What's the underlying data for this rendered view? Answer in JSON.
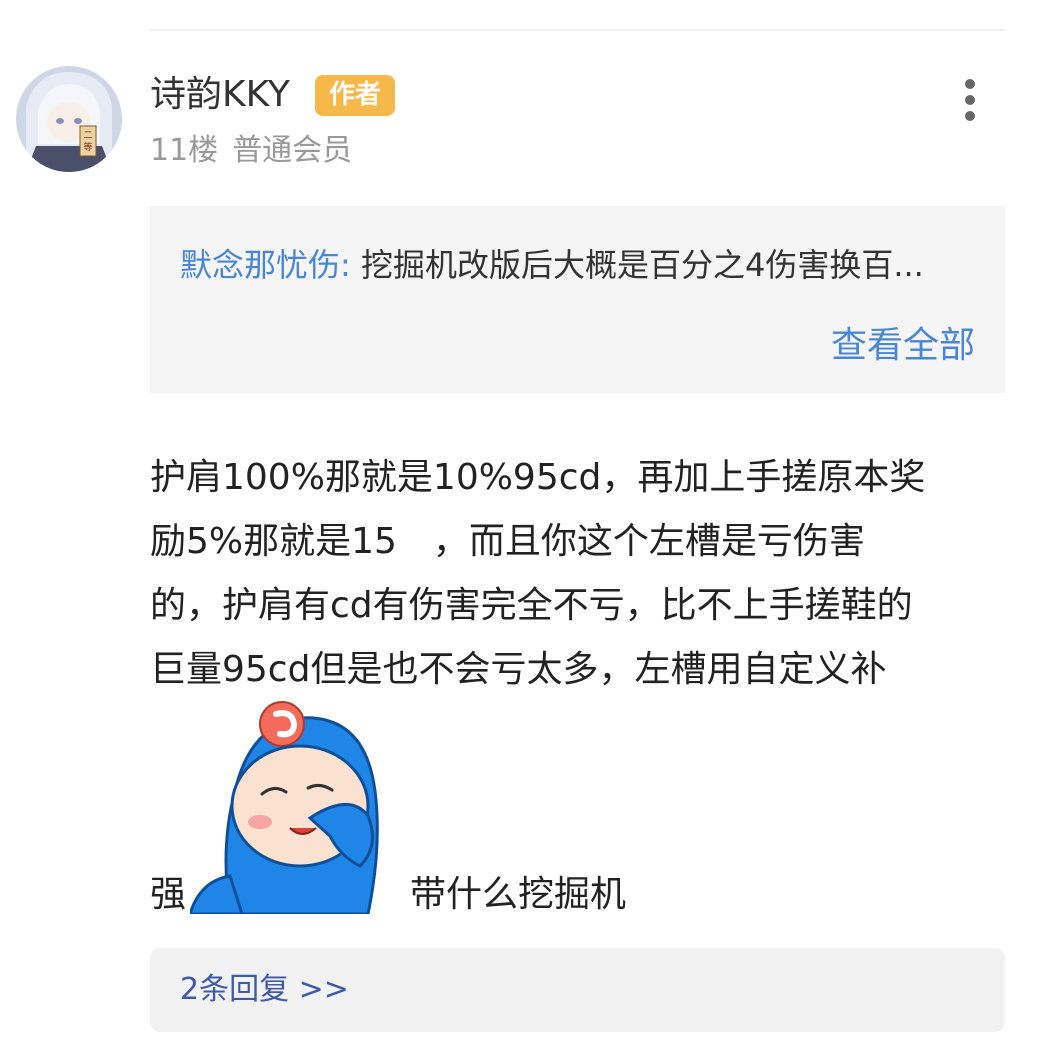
{
  "post": {
    "username": "诗韵KKY",
    "badge": "作者",
    "floor": "11楼",
    "member_level": "普通会员",
    "quote": {
      "author": "默念那忧伤:",
      "text": " 挖掘机改版后大概是百分之4伤害换百..."
    },
    "view_all": "查看全部",
    "content_lines": [
      "护肩100%那就是10%95cd，再加上手搓原本奖",
      "励5%那就是15　，而且你这个左槽是亏伤害",
      "的，护肩有cd有伤害完全不亏，比不上手搓鞋的",
      "巨量95cd但是也不会亏太多，左槽用自定义补"
    ],
    "before_sticker": "强",
    "after_sticker": "带什么挖掘机",
    "replies": "2条回复 >>"
  },
  "icons": {
    "more": "more-vertical-icon",
    "sticker": "blue-hooded-character-emoji"
  },
  "colors": {
    "badge": "#f7b84a",
    "link": "#4a86d8",
    "reply_link": "#3d5aa8",
    "quote_bg": "#f5f5f5"
  }
}
